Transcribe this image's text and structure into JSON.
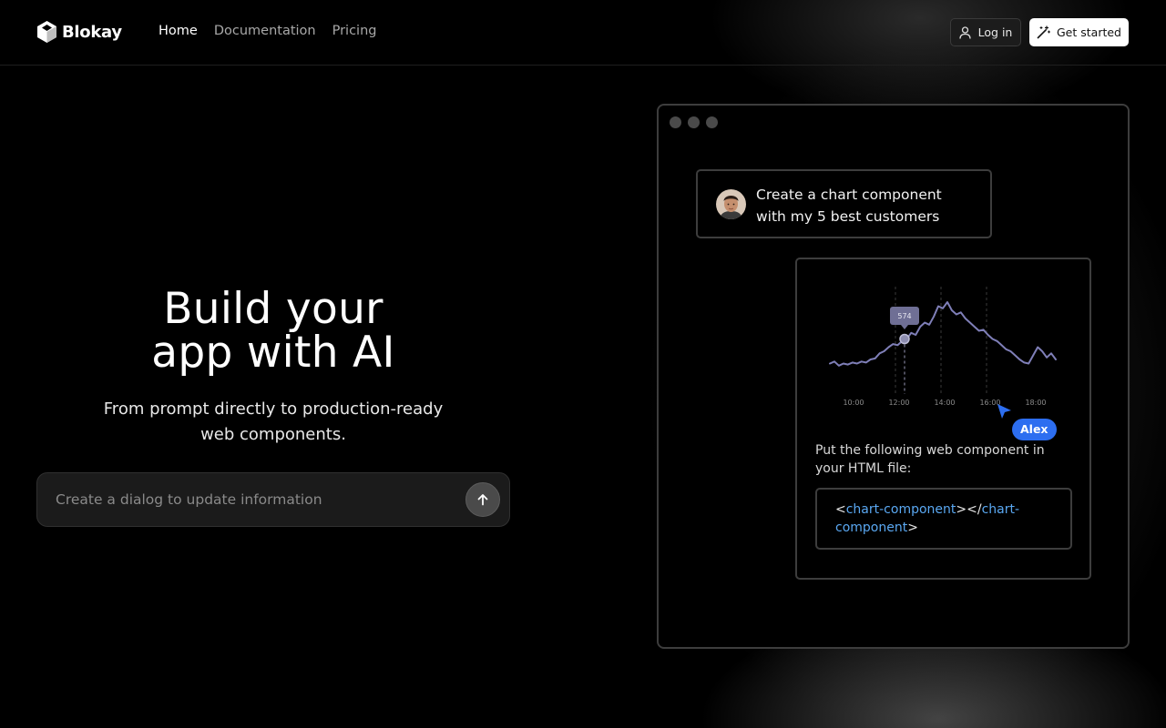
{
  "app": {
    "brand": "Blokay"
  },
  "nav": {
    "links": [
      {
        "label": "Home",
        "active": true
      },
      {
        "label": "Documentation",
        "active": false
      },
      {
        "label": "Pricing",
        "active": false
      }
    ],
    "login_label": "Log in",
    "login_icon": "user-icon",
    "get_started_label": "Get started",
    "get_started_icon": "magic-wand-icon"
  },
  "hero": {
    "title_line1": "Build your",
    "title_line2": "app with AI",
    "subtitle_line1": "From prompt directly to production-ready",
    "subtitle_line2": "web components.",
    "prompt_placeholder": "Create a dialog to update information",
    "send_icon": "arrow-up-icon"
  },
  "demo": {
    "chat_message_line1": "Create a chart component",
    "chat_message_line2": "with my 5 best customers",
    "chart_tooltip": "574",
    "chart_ticks": [
      "10:00",
      "12:00",
      "14:00",
      "16:00",
      "18:00"
    ],
    "user_badge": "Alex",
    "instruction": "Put the following web component in your HTML file:",
    "code": {
      "lt": "<",
      "open_tag": "chart-component",
      "middle": "></",
      "close_tag_a": "chart-",
      "close_tag_b": "component",
      "gt": ">"
    }
  },
  "colors": {
    "background": "#000000",
    "accent_blue": "#2d6ef0",
    "code_tag": "#5aa8f2",
    "chart_line": "#7f7fb8"
  },
  "chart_data": {
    "type": "line",
    "x": [
      "10:00",
      "12:00",
      "14:00",
      "16:00",
      "18:00"
    ],
    "annotation": {
      "label": "574",
      "x": "12:00"
    },
    "series": [
      {
        "values": [
          12,
          14,
          10,
          12,
          11,
          13,
          12,
          14,
          13,
          16,
          17,
          22,
          24,
          28,
          31,
          30,
          34,
          36,
          42,
          40,
          48,
          52,
          50,
          58,
          68,
          66,
          72,
          64,
          60,
          62,
          56,
          52,
          48,
          44,
          45,
          40,
          36,
          34,
          30,
          26,
          24,
          20,
          16,
          13,
          12,
          20,
          28,
          24,
          18,
          22,
          16
        ]
      }
    ]
  }
}
